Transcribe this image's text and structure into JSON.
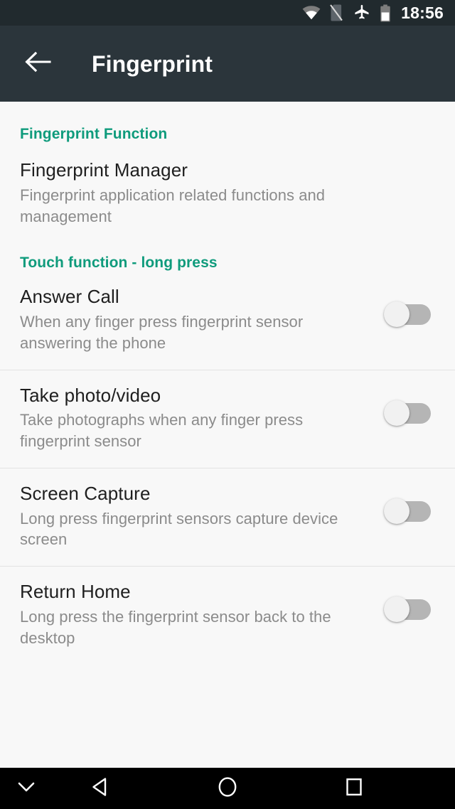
{
  "status_bar": {
    "time": "18:56",
    "icons": [
      {
        "name": "wifi-icon",
        "label": "wifi"
      },
      {
        "name": "no-sim-icon",
        "label": "no sim card"
      },
      {
        "name": "airplane-mode-icon",
        "label": "airplane mode"
      },
      {
        "name": "battery-icon",
        "label": "battery"
      }
    ],
    "background_color": "#212a2e"
  },
  "app_bar": {
    "title": "Fingerprint",
    "back_icon": "arrow-left-icon",
    "background_color": "#2b353b",
    "title_color": "#ffffff"
  },
  "theme": {
    "accent_color": "#0f9b7c",
    "page_background": "#f8f8f8",
    "title_color": "#1f1f1f",
    "summary_color": "#8b8b8b",
    "divider_color": "#e2e2e2",
    "switch_track_off_color": "#b5b5b5",
    "switch_thumb_off_color": "#f1f1f1"
  },
  "sections": [
    {
      "header": "Fingerprint Function",
      "items": [
        {
          "title": "Fingerprint Manager",
          "summary": "Fingerprint application related functions and management",
          "has_switch": false
        }
      ]
    },
    {
      "header": "Touch function - long press",
      "items": [
        {
          "title": "Answer Call",
          "summary": "When any finger press fingerprint sensor answering the phone",
          "has_switch": true,
          "switch_state": "off"
        },
        {
          "title": "Take photo/video",
          "summary": "Take photographs when any finger press fingerprint sensor",
          "has_switch": true,
          "switch_state": "off"
        },
        {
          "title": "Screen Capture",
          "summary": "Long press fingerprint sensors capture device screen",
          "has_switch": true,
          "switch_state": "off"
        },
        {
          "title": "Return Home",
          "summary": "Long press the fingerprint sensor back to the desktop",
          "has_switch": true,
          "switch_state": "off"
        }
      ]
    }
  ],
  "nav_bar": {
    "buttons": [
      {
        "name": "ime-hide-icon",
        "label": "hide keyboard"
      },
      {
        "name": "back-icon",
        "label": "back"
      },
      {
        "name": "home-icon",
        "label": "home"
      },
      {
        "name": "recents-icon",
        "label": "recent apps"
      }
    ],
    "background_color": "#000000"
  }
}
